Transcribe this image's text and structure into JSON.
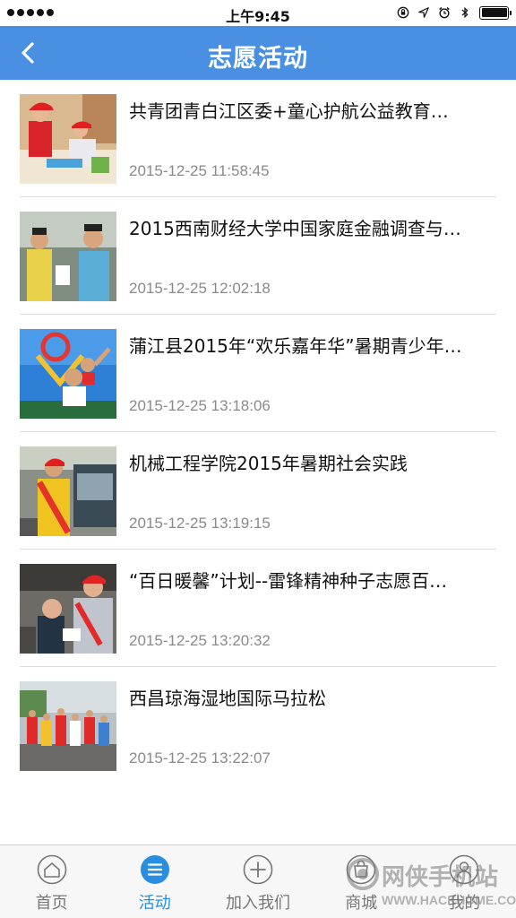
{
  "status_bar": {
    "time": "上午9:45",
    "icons": [
      "signal-dots-icon",
      "lock-rotation-icon",
      "location-arrow-icon",
      "alarm-icon",
      "bluetooth-icon",
      "battery-icon"
    ]
  },
  "header": {
    "title": "志愿活动",
    "back_icon": "chevron-left-icon",
    "background_color": "#4a90e2"
  },
  "activities": [
    {
      "title": "共青团青白江区委+童心护航公益教育…",
      "date": "2015-12-25 11:58:45"
    },
    {
      "title": "2015西南财经大学中国家庭金融调查与…",
      "date": "2015-12-25 12:02:18"
    },
    {
      "title": "蒲江县2015年“欢乐嘉年华”暑期青少年…",
      "date": "2015-12-25 13:18:06"
    },
    {
      "title": "机械工程学院2015年暑期社会实践",
      "date": "2015-12-25 13:19:15"
    },
    {
      "title": "“百日暖馨”计划--雷锋精神种子志愿百…",
      "date": "2015-12-25 13:20:32"
    },
    {
      "title": "西昌琼海湿地国际马拉松",
      "date": "2015-12-25 13:22:07"
    }
  ],
  "tab_bar": {
    "active_color": "#2a8ee0",
    "tabs": [
      {
        "label": "首页",
        "icon": "home-icon",
        "active": false
      },
      {
        "label": "活动",
        "icon": "list-icon",
        "active": true
      },
      {
        "label": "加入我们",
        "icon": "plus-circle-icon",
        "active": false
      },
      {
        "label": "商城",
        "icon": "shop-icon",
        "active": false
      },
      {
        "label": "我的",
        "icon": "user-icon",
        "active": false
      }
    ]
  },
  "watermark": {
    "text": "网侠手机站",
    "url": "WWW.HACKHOME.COM"
  }
}
